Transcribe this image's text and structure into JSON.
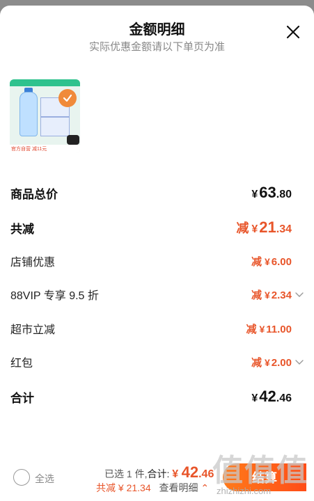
{
  "sheet": {
    "title": "金额明细",
    "subtitle": "实际优惠金额请以下单页为准"
  },
  "product": {
    "image_icon": "product-image",
    "tag_text": "官方自营 减11元",
    "selected": true
  },
  "rows": [
    {
      "label": "商品总价",
      "prefix": "",
      "yen": "¥",
      "int": "63",
      "dec": ".80",
      "style": "total",
      "chevron": false
    },
    {
      "label": "共减",
      "prefix": "减",
      "yen": "¥",
      "int": "21",
      "dec": ".34",
      "style": "discount-total",
      "chevron": false
    },
    {
      "label": "店铺优惠",
      "prefix": "减",
      "yen": "¥",
      "int": "6",
      "dec": ".00",
      "style": "discount",
      "chevron": false
    },
    {
      "label": "88VIP 专享 9.5 折",
      "prefix": "减",
      "yen": "¥",
      "int": "2",
      "dec": ".34",
      "style": "discount",
      "chevron": true
    },
    {
      "label": "超市立减",
      "prefix": "减",
      "yen": "¥",
      "int": "11",
      "dec": ".00",
      "style": "discount",
      "chevron": false
    },
    {
      "label": "红包",
      "prefix": "减",
      "yen": "¥",
      "int": "2",
      "dec": ".00",
      "style": "discount",
      "chevron": true
    },
    {
      "label": "合计",
      "prefix": "",
      "yen": "¥",
      "int": "42",
      "dec": ".46",
      "style": "total",
      "chevron": false
    }
  ],
  "bottom": {
    "select_all": "全选",
    "selected_count": "已选 1 件,",
    "total_label": "合计:",
    "total_yen": "¥",
    "total_int": "42",
    "total_dec": ".46",
    "discount_text": "共减 ¥ 21.34",
    "view_detail": "查看明细",
    "checkout": "结算"
  },
  "watermark": {
    "big": "值值值",
    "small": "zhizhizhi.com"
  },
  "colors": {
    "accent": "#e8552a",
    "checkout_start": "#ff7a1a",
    "checkout_end": "#ff4d17"
  },
  "icons": {
    "close": "close-icon",
    "chevron": "chevron-down-icon",
    "check": "check-icon"
  }
}
